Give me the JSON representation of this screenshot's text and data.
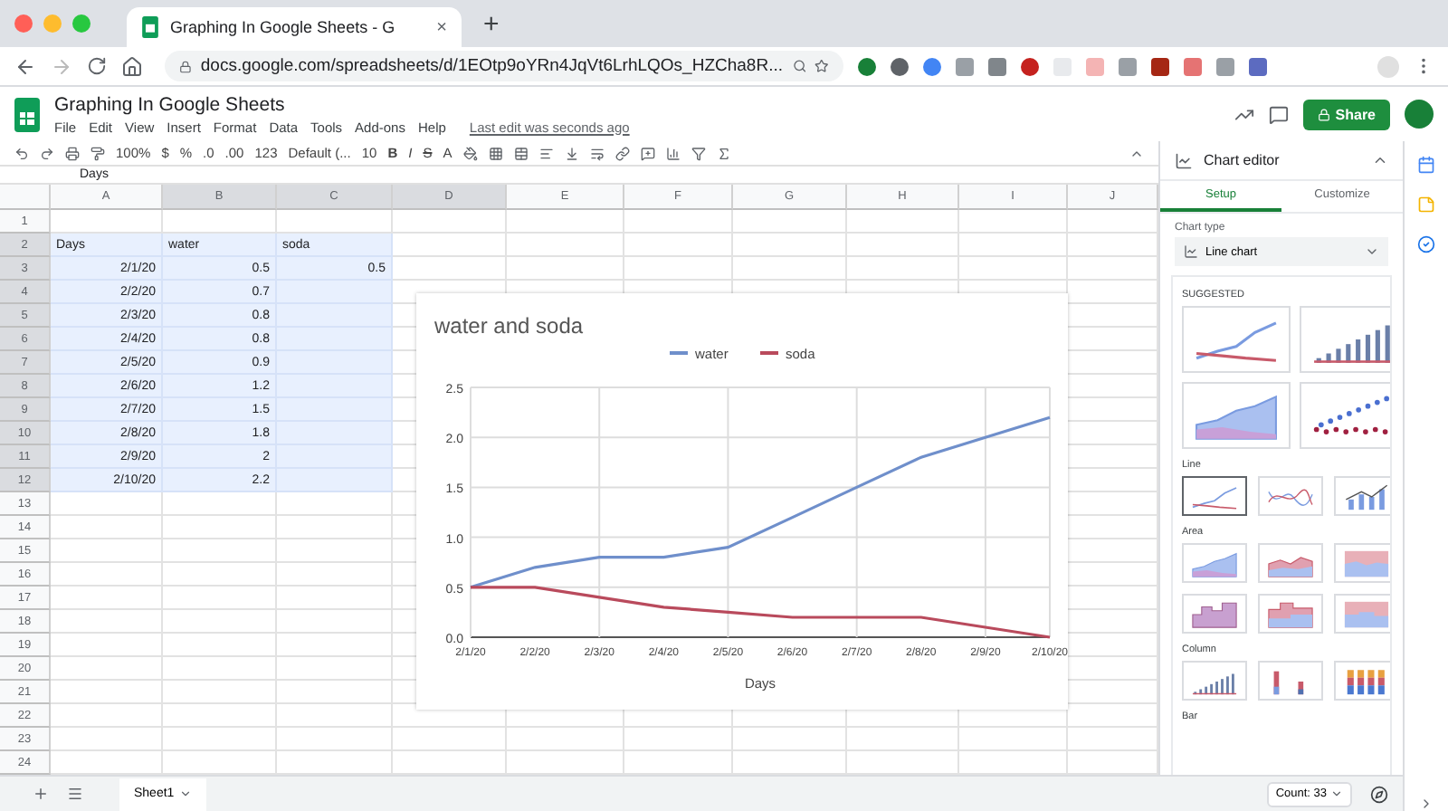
{
  "browser": {
    "tab_title": "Graphing In Google Sheets - G",
    "tab_close": "×",
    "new_tab": "+",
    "url": "docs.google.com/spreadsheets/d/1EOtp9oYRn4JqVt6LrhLQOs_HZCha8R..."
  },
  "document": {
    "title": "Graphing In Google Sheets",
    "menu": [
      "File",
      "Edit",
      "View",
      "Insert",
      "Format",
      "Data",
      "Tools",
      "Add-ons",
      "Help"
    ],
    "last_edit": "Last edit was seconds ago",
    "share": "Share"
  },
  "toolbar": {
    "zoom": "100%",
    "number_formats": [
      "$",
      "%",
      ".0",
      ".00",
      "123"
    ],
    "font": "Default (...",
    "font_size": "10",
    "text_styles": [
      "B",
      "I",
      "S",
      "A"
    ]
  },
  "formula_bar": {
    "value": "Days"
  },
  "sheet": {
    "columns": [
      "A",
      "B",
      "C",
      "D",
      "E",
      "F",
      "G",
      "H",
      "I",
      "J"
    ],
    "row_numbers": [
      "1",
      "2",
      "3",
      "4",
      "5",
      "6",
      "7",
      "8",
      "9",
      "10",
      "11",
      "12",
      "13",
      "14",
      "15",
      "16",
      "17",
      "18",
      "19",
      "20",
      "21",
      "22",
      "23",
      "24"
    ],
    "table": {
      "selected": true,
      "header": [
        "Days",
        "water",
        "soda"
      ],
      "rows": [
        {
          "days": "2/1/20",
          "water": "0.5",
          "soda": "0.5"
        },
        {
          "days": "2/2/20",
          "water": "0.7"
        },
        {
          "days": "2/3/20",
          "water": "0.8"
        },
        {
          "days": "2/4/20",
          "water": "0.8"
        },
        {
          "days": "2/5/20",
          "water": "0.9"
        },
        {
          "days": "2/6/20",
          "water": "1.2"
        },
        {
          "days": "2/7/20",
          "water": "1.5"
        },
        {
          "days": "2/8/20",
          "water": "1.8"
        },
        {
          "days": "2/9/20",
          "water": "2"
        },
        {
          "days": "2/10/20",
          "water": "2.2"
        }
      ]
    }
  },
  "chart": {
    "chart_data": {
      "type": "line",
      "title": "water and soda",
      "xlabel": "Days",
      "categories": [
        "2/1/20",
        "2/2/20",
        "2/3/20",
        "2/4/20",
        "2/5/20",
        "2/6/20",
        "2/7/20",
        "2/8/20",
        "2/9/20",
        "2/10/20"
      ],
      "series": [
        {
          "name": "water",
          "color": "#6f8fcb",
          "values": [
            0.5,
            0.7,
            0.8,
            0.8,
            0.9,
            1.2,
            1.5,
            1.8,
            2,
            2.2
          ]
        },
        {
          "name": "soda",
          "color": "#b94a5c",
          "values": [
            0.5,
            0.5,
            0.4,
            0.3,
            0.25,
            0.2,
            0.2,
            0.2,
            0.1,
            0
          ]
        }
      ],
      "grid": true,
      "legend": true,
      "ylim": [
        0,
        2.5
      ],
      "yticks": [
        {
          "value": 0,
          "label": "0.0"
        },
        {
          "value": 0.5,
          "label": "0.5"
        },
        {
          "value": 1,
          "label": "1.0"
        },
        {
          "value": 1.5,
          "label": "1.5"
        },
        {
          "value": 2,
          "label": "2.0"
        },
        {
          "value": 2.5,
          "label": "2.5"
        }
      ]
    }
  },
  "chart_editor": {
    "title": "Chart editor",
    "tabs": [
      {
        "label": "Setup",
        "selected": true
      },
      {
        "label": "Customize",
        "selected": false
      }
    ],
    "chart_type_label": "Chart type",
    "chart_type": "Line chart",
    "sections": [
      {
        "kind": "suggested",
        "title": "SUGGESTED",
        "options": [
          {
            "kind": "line",
            "selected": false
          },
          {
            "kind": "column",
            "selected": false
          },
          {
            "kind": "area",
            "selected": false
          },
          {
            "kind": "scatter",
            "selected": false
          }
        ]
      },
      {
        "kind": "group",
        "title": "Line",
        "options": [
          {
            "kind": "line",
            "selected": true
          },
          {
            "kind": "smooth",
            "selected": false
          },
          {
            "kind": "combo",
            "selected": false
          }
        ]
      },
      {
        "kind": "group",
        "title": "Area",
        "options": [
          {
            "kind": "area",
            "selected": false
          },
          {
            "kind": "stacked-area",
            "selected": false
          },
          {
            "kind": "full-area",
            "selected": false
          },
          {
            "kind": "stepped-area",
            "selected": false
          },
          {
            "kind": "stacked-stepped",
            "selected": false
          },
          {
            "kind": "full-stepped",
            "selected": false
          }
        ]
      },
      {
        "kind": "group",
        "title": "Column",
        "options": [
          {
            "kind": "column",
            "selected": false
          },
          {
            "kind": "stacked-column",
            "selected": false
          },
          {
            "kind": "full-column",
            "selected": false
          }
        ]
      },
      {
        "kind": "group",
        "title": "Bar"
      }
    ]
  },
  "bottom_bar": {
    "sheets": [
      {
        "name": "Sheet1",
        "selected": true
      }
    ],
    "summary": "Count: 33"
  }
}
